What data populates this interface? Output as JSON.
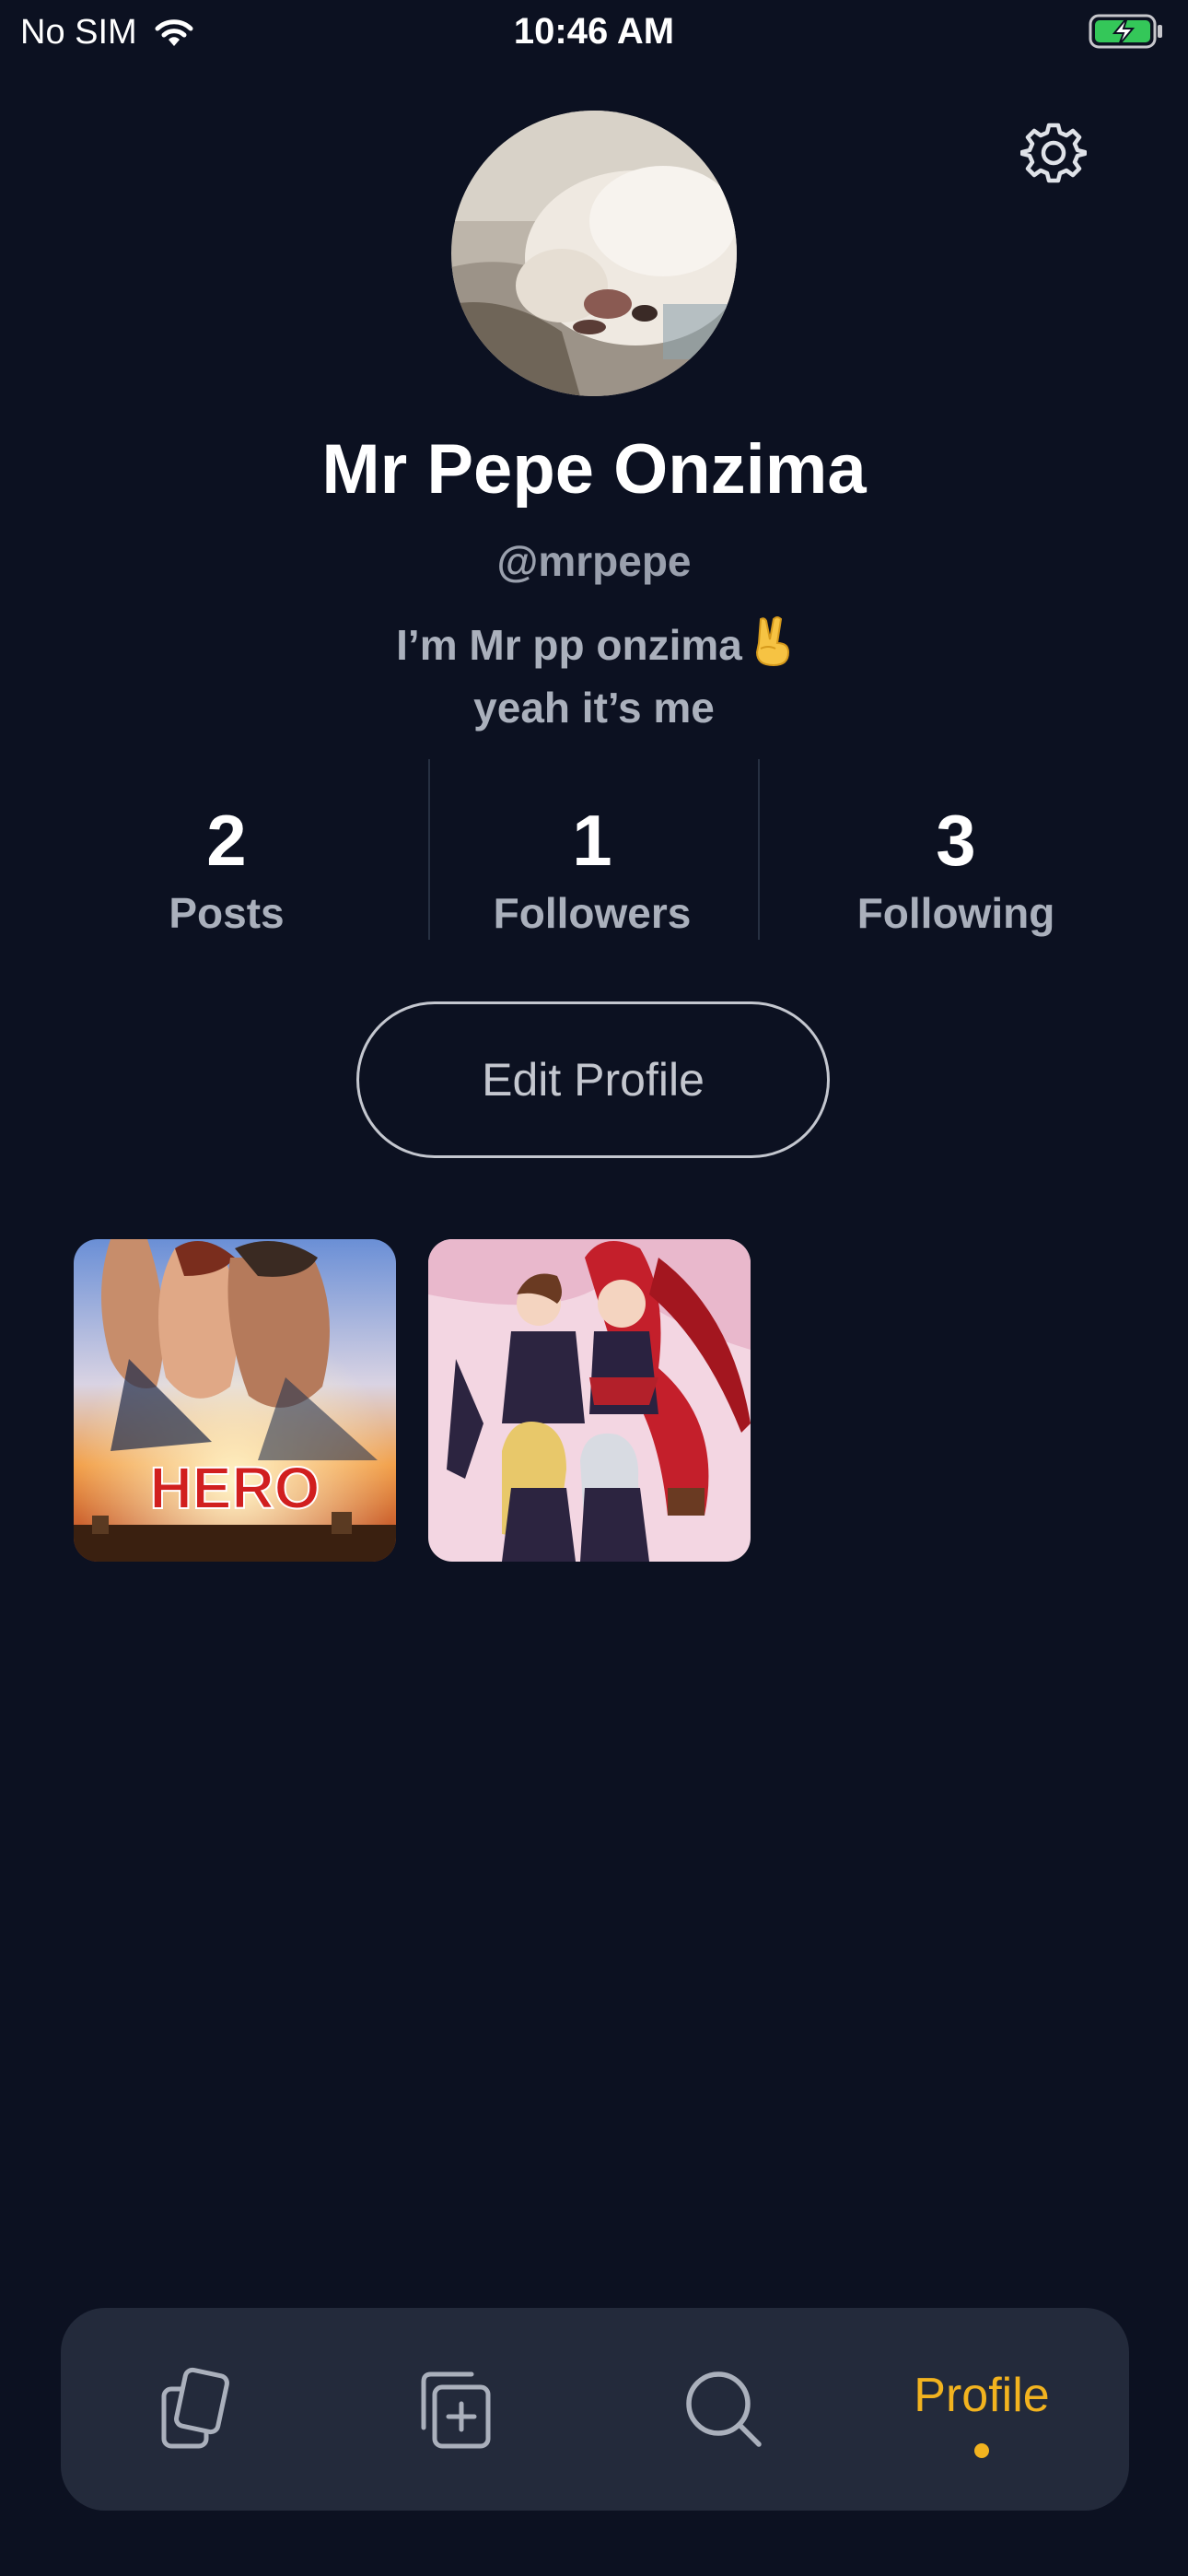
{
  "status_bar": {
    "carrier": "No SIM",
    "time": "10:46 AM",
    "wifi_icon": "wifi-icon",
    "battery_icon": "battery-charging-icon"
  },
  "header": {
    "settings_icon": "gear-icon"
  },
  "profile": {
    "name": "Mr Pepe Onzima",
    "handle": "@mrpepe",
    "bio_line_1": "I’m Mr pp onzima",
    "bio_line_2": "yeah it’s me",
    "bio_emoji_icon": "victory-hand-icon"
  },
  "stats": [
    {
      "value": "2",
      "label": "Posts"
    },
    {
      "value": "1",
      "label": "Followers"
    },
    {
      "value": "3",
      "label": "Following"
    }
  ],
  "edit_profile_label": "Edit Profile",
  "posts": [
    {
      "kind": "movie-poster",
      "poster_text": "HERO"
    },
    {
      "kind": "anime-artwork"
    }
  ],
  "tab_bar": {
    "items": [
      {
        "icon": "cards-icon",
        "active": false
      },
      {
        "icon": "add-post-icon",
        "active": false
      },
      {
        "icon": "search-icon",
        "active": false
      },
      {
        "label": "Profile",
        "active": true
      }
    ]
  },
  "colors": {
    "background": "#0c1121",
    "tab_bar": "#232a3b",
    "accent": "#f2b31f",
    "muted_text": "#aab0bc",
    "divider": "#273042",
    "battery_green": "#34c759"
  }
}
